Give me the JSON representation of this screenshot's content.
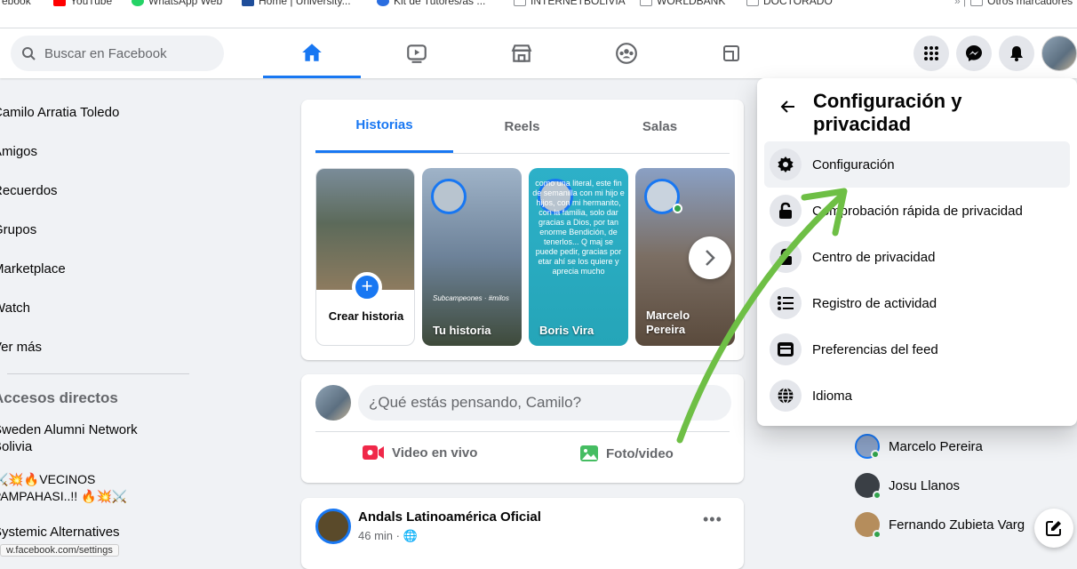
{
  "bookmarks": [
    {
      "label": "ebook",
      "color": "#888888"
    },
    {
      "label": "YouTube",
      "color": "#ff0000"
    },
    {
      "label": "WhatsApp Web",
      "color": "#25d366"
    },
    {
      "label": "Home | University...",
      "color": "#1f4e9a"
    },
    {
      "label": "Kit de Tutores/as ...",
      "color": "#2a6de0"
    },
    {
      "label": "INTERNETBOLIVIA",
      "color": "#8a8d91"
    },
    {
      "label": "WORLDBANK",
      "color": "#8a8d91"
    },
    {
      "label": "DOCTORADO",
      "color": "#8a8d91"
    },
    {
      "label": "Otros marcadores",
      "color": "#8a8d91"
    }
  ],
  "topnav": {
    "search_placeholder": "Buscar en Facebook",
    "tabs": [
      "home",
      "watch",
      "marketplace",
      "groups",
      "gaming"
    ],
    "active_tab": "home",
    "accent": "#1877f2"
  },
  "sidebar": {
    "items": [
      "Camilo Arratia Toledo",
      "Amigos",
      "Recuerdos",
      "Grupos",
      "Marketplace",
      "Watch",
      "Ver más"
    ],
    "shortcuts_heading": "Accesos directos",
    "shortcuts": [
      "Sweden Alumni Network Bolivia",
      "⚔️💥🔥VECINOS PAMPAHASI..!! 🔥💥⚔️",
      "Systemic Alternatives"
    ]
  },
  "stories": {
    "tabs": [
      "Historias",
      "Reels",
      "Salas"
    ],
    "active": "Historias",
    "create_label": "Crear historia",
    "cards": [
      {
        "name": "Tu historia",
        "overlay": "Subcampeones · #milos"
      },
      {
        "name": "Boris Vira",
        "overlay": "como una literal, este fin de semanilla con mi hijo e hijos, con mi hermanito, con la familia, solo dar gracias a Dios, por tan enorme Bendición, de tenerlos... Q maj se puede pedir, gracias por etar ahí se los quiere y aprecia mucho"
      },
      {
        "name": "Marcelo Pereira",
        "overlay": ""
      }
    ]
  },
  "composer": {
    "placeholder": "¿Qué estás pensando, Camilo?",
    "live_label": "Video en vivo",
    "photo_label": "Foto/video"
  },
  "post": {
    "author": "Andals Latinoamérica Oficial",
    "meta": "46 min · 🌐"
  },
  "settings_menu": {
    "title": "Configuración y privacidad",
    "items": [
      {
        "label": "Configuración",
        "icon": "gear-icon"
      },
      {
        "label": "Comprobación rápida de privacidad",
        "icon": "lock-icon"
      },
      {
        "label": "Centro de privacidad",
        "icon": "lock-icon"
      },
      {
        "label": "Registro de actividad",
        "icon": "list-icon"
      },
      {
        "label": "Preferencias del feed",
        "icon": "feed-icon"
      },
      {
        "label": "Idioma",
        "icon": "globe-icon"
      }
    ]
  },
  "contacts": [
    "Marcelo Pereira",
    "Josu Llanos",
    "Fernando Zubieta Varg"
  ],
  "statusbar": "w.facebook.com/settings",
  "annotation_color": "#6ebf45"
}
